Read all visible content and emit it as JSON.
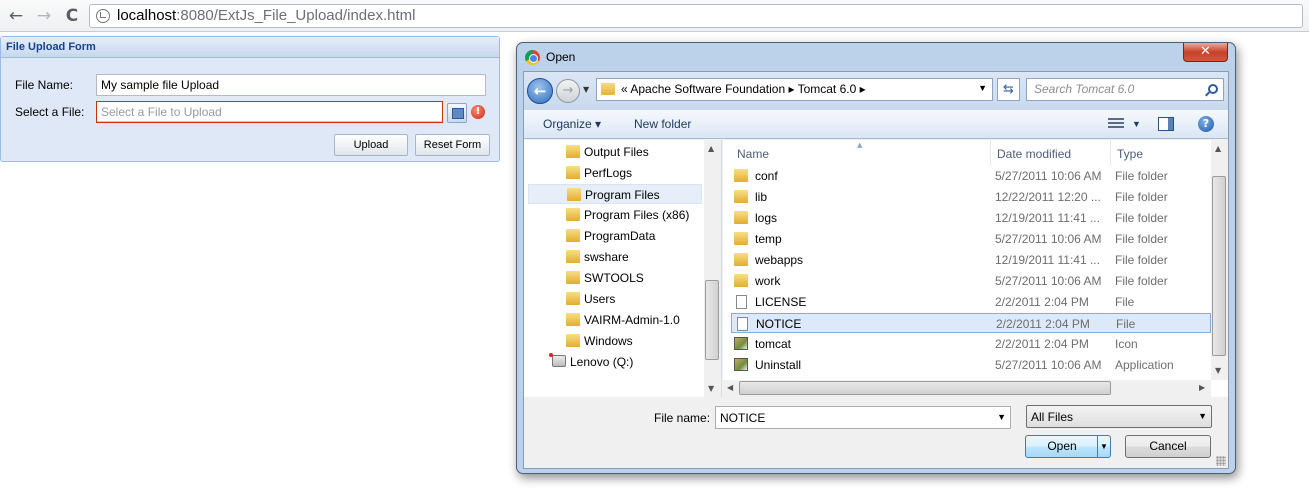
{
  "browser": {
    "back_glyph": "←",
    "forward_glyph": "→",
    "reload_glyph": "C",
    "url_host": "localhost",
    "url_rest": ":8080/ExtJs_File_Upload/index.html"
  },
  "form": {
    "title": "File Upload Form",
    "file_name_label": "File Name:",
    "file_name_value": "My sample file Upload",
    "select_file_label": "Select a File:",
    "select_file_placeholder": "Select a File to Upload",
    "error_glyph": "!",
    "upload_label": "Upload",
    "reset_label": "Reset Form"
  },
  "dialog": {
    "title": "Open",
    "close_glyph": "✕",
    "path": "«  Apache Software Foundation  ▸  Tomcat 6.0  ▸",
    "search_placeholder": "Search Tomcat 6.0",
    "toolbar": {
      "organize": "Organize ▾",
      "new_folder": "New folder",
      "help_glyph": "?"
    },
    "nav_items": [
      {
        "label": "Output Files"
      },
      {
        "label": "PerfLogs"
      },
      {
        "label": "Program Files"
      },
      {
        "label": "Program Files (x86)"
      },
      {
        "label": "ProgramData"
      },
      {
        "label": "swshare"
      },
      {
        "label": "SWTOOLS"
      },
      {
        "label": "Users"
      },
      {
        "label": "VAIRM-Admin-1.0"
      },
      {
        "label": "Windows"
      },
      {
        "label": "Lenovo (Q:)"
      }
    ],
    "columns": {
      "name": "Name",
      "date": "Date modified",
      "type": "Type"
    },
    "files": [
      {
        "name": "conf",
        "date": "5/27/2011 10:06 AM",
        "type": "File folder",
        "icon": "folder-icon"
      },
      {
        "name": "lib",
        "date": "12/22/2011 12:20 ...",
        "type": "File folder",
        "icon": "folder-icon"
      },
      {
        "name": "logs",
        "date": "12/19/2011 11:41 ...",
        "type": "File folder",
        "icon": "folder-icon"
      },
      {
        "name": "temp",
        "date": "5/27/2011 10:06 AM",
        "type": "File folder",
        "icon": "folder-icon"
      },
      {
        "name": "webapps",
        "date": "12/19/2011 11:41 ...",
        "type": "File folder",
        "icon": "folder-icon"
      },
      {
        "name": "work",
        "date": "5/27/2011 10:06 AM",
        "type": "File folder",
        "icon": "folder-icon"
      },
      {
        "name": "LICENSE",
        "date": "2/2/2011 2:04 PM",
        "type": "File",
        "icon": "document-icon"
      },
      {
        "name": "NOTICE",
        "date": "2/2/2011 2:04 PM",
        "type": "File",
        "icon": "document-icon"
      },
      {
        "name": "tomcat",
        "date": "2/2/2011 2:04 PM",
        "type": "Icon",
        "icon": "app-icon"
      },
      {
        "name": "Uninstall",
        "date": "5/27/2011 10:06 AM",
        "type": "Application",
        "icon": "app-icon"
      }
    ],
    "file_name_label": "File name:",
    "file_name_value": "NOTICE",
    "filter_value": "All Files",
    "open_label": "Open",
    "cancel_label": "Cancel"
  }
}
